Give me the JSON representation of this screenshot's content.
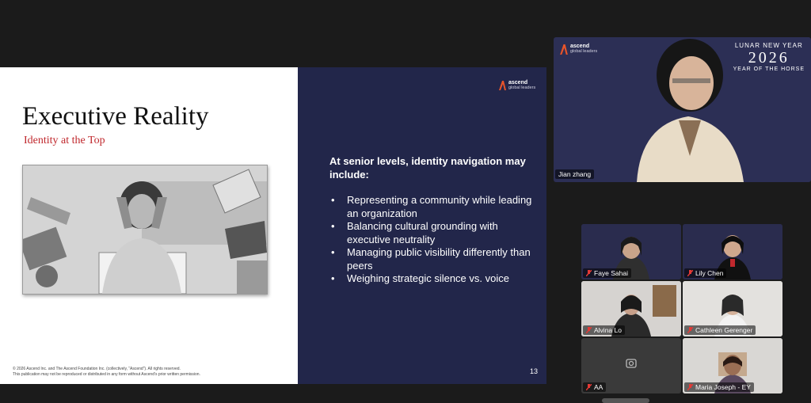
{
  "slide": {
    "title": "Executive Reality",
    "subtitle": "Identity at the Top",
    "intro": "At senior levels, identity navigation may include:",
    "bullets": [
      "Representing a community while leading an organization",
      "Balancing cultural grounding with executive neutrality",
      "Managing public visibility differently than peers",
      "Weighing strategic silence vs. voice"
    ],
    "page_number": "13",
    "footer_line1": "© 2026 Ascend Inc. and The Ascend Foundation Inc. (collectively, “Ascend”).  All rights reserved.",
    "footer_line2": "This publication may not be reproduced or distributed in any form without Ascend’s prior written permission.",
    "logo_name": "ascend",
    "logo_sub": "global leaders"
  },
  "speaker": {
    "name": "Jian zhang",
    "banner_line1": "LUNAR NEW YEAR",
    "banner_year": "2026",
    "banner_line2": "YEAR OF THE HORSE"
  },
  "participants": [
    {
      "name": "Faye Sahai"
    },
    {
      "name": "Lily Chen"
    },
    {
      "name": "Alvina Lo"
    },
    {
      "name": "Cathleen Gerenger"
    },
    {
      "name": "AA"
    },
    {
      "name": "Maria Joseph - EY"
    }
  ],
  "colors": {
    "slide_navy": "#22264a",
    "accent_red": "#c0282d",
    "ascend_orange": "#e8542a"
  }
}
